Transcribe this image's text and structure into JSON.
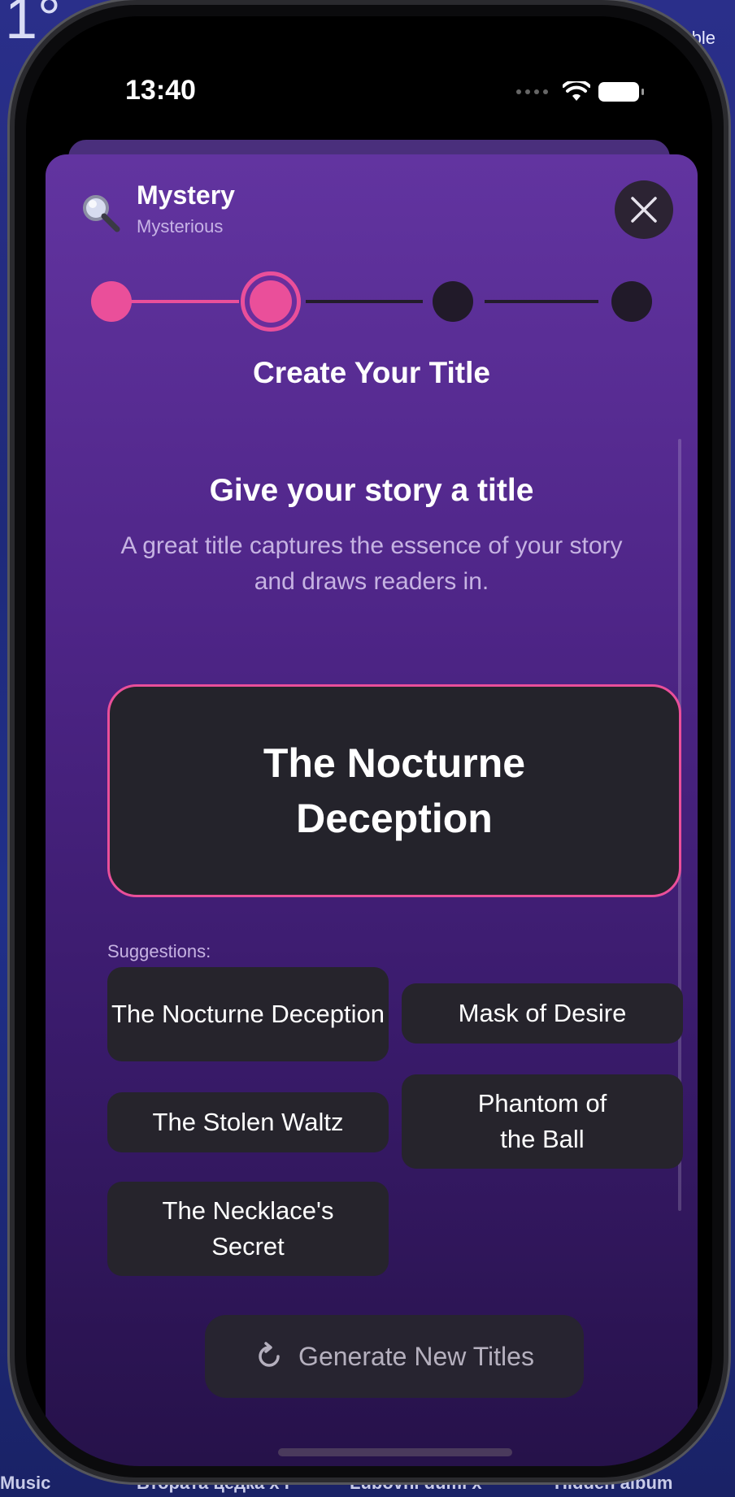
{
  "status_bar": {
    "time": "13:40"
  },
  "header": {
    "genre_title": "Mystery",
    "genre_subtitle": "Mysterious",
    "icon": "magnifying-glass-icon"
  },
  "stepper": {
    "current_step": 2,
    "total_steps": 4,
    "step_title": "Create Your Title"
  },
  "content": {
    "headline": "Give your story a title",
    "description": "A great title captures the essence of your story and draws readers in.",
    "selected_title": "The Nocturne Deception",
    "suggestions_label": "Suggestions:",
    "suggestions": [
      "The Nocturne Deception",
      "Mask of Desire",
      "The Stolen Waltz",
      "Phantom of the Ball",
      "The Necklace's Secret"
    ]
  },
  "footer": {
    "generate_label": "Generate New Titles",
    "generate_icon": "refresh-icon"
  },
  "background": {
    "top_left": "1°",
    "top_right": "ble",
    "bottom_labels": [
      "Music",
      "Втората цедка x I",
      "Lubovni dumi x",
      "Hidden album"
    ]
  },
  "colors": {
    "accent_pink": "#ea4f9a",
    "sheet_top": "#6234a0",
    "sheet_bottom": "#251148",
    "chip_bg": "#26242c"
  }
}
